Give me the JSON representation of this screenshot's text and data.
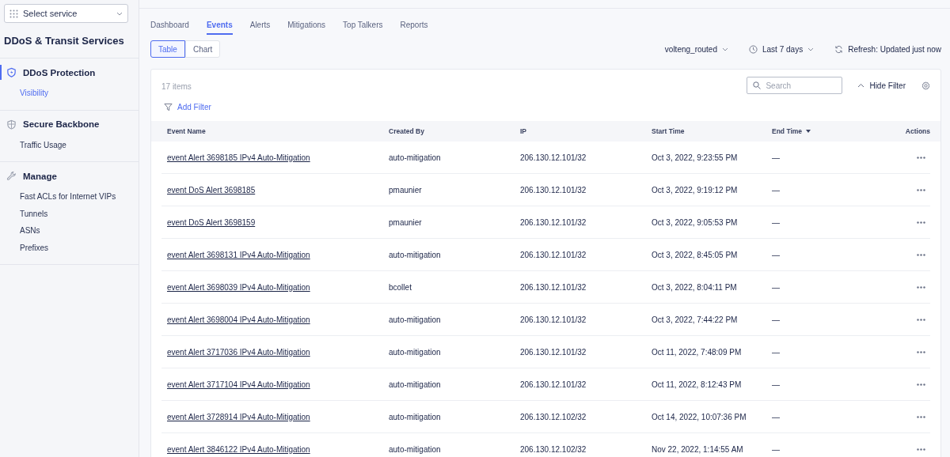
{
  "sidebar": {
    "service_select": {
      "placeholder": "Select service"
    },
    "title": "DDoS & Transit Services",
    "sections": [
      {
        "label": "DDoS Protection",
        "selected": true,
        "items": [
          {
            "label": "Visibility",
            "selected": true
          }
        ]
      },
      {
        "label": "Secure Backbone",
        "selected": false,
        "items": [
          {
            "label": "Traffic Usage",
            "selected": false
          }
        ]
      },
      {
        "label": "Manage",
        "selected": false,
        "items": [
          {
            "label": "Fast ACLs for Internet VIPs",
            "selected": false
          },
          {
            "label": "Tunnels",
            "selected": false
          },
          {
            "label": "ASNs",
            "selected": false
          },
          {
            "label": "Prefixes",
            "selected": false
          }
        ]
      }
    ]
  },
  "tabs": [
    {
      "label": "Dashboard",
      "selected": false
    },
    {
      "label": "Events",
      "selected": true
    },
    {
      "label": "Alerts",
      "selected": false
    },
    {
      "label": "Mitigations",
      "selected": false
    },
    {
      "label": "Top Talkers",
      "selected": false
    },
    {
      "label": "Reports",
      "selected": false
    }
  ],
  "views": [
    {
      "label": "Table",
      "selected": true
    },
    {
      "label": "Chart",
      "selected": false
    }
  ],
  "toolbar": {
    "account": "volteng_routed",
    "time_range": "Last 7 days",
    "refresh": "Refresh: Updated just now"
  },
  "table": {
    "count": "17 items",
    "search": {
      "placeholder": "Search"
    },
    "hide_filter": "Hide Filter",
    "add_filter": "Add Filter",
    "columns": [
      {
        "label": "Event Name",
        "sorted": false
      },
      {
        "label": "Created By",
        "sorted": false
      },
      {
        "label": "IP",
        "sorted": false
      },
      {
        "label": "Start Time",
        "sorted": false
      },
      {
        "label": "End Time",
        "sorted": true
      },
      {
        "label": "Actions",
        "sorted": false
      }
    ],
    "rows": [
      {
        "name": "event Alert 3698185 IPv4 Auto-Mitigation",
        "created_by": "auto-mitigation",
        "ip": "206.130.12.101/32",
        "start": "Oct 3, 2022, 9:23:55 PM",
        "end": "—"
      },
      {
        "name": "event DoS Alert 3698185",
        "created_by": "pmaunier",
        "ip": "206.130.12.101/32",
        "start": "Oct 3, 2022, 9:19:12 PM",
        "end": "—"
      },
      {
        "name": "event DoS Alert 3698159",
        "created_by": "pmaunier",
        "ip": "206.130.12.101/32",
        "start": "Oct 3, 2022, 9:05:53 PM",
        "end": "—"
      },
      {
        "name": "event Alert 3698131 IPv4 Auto-Mitigation",
        "created_by": "auto-mitigation",
        "ip": "206.130.12.101/32",
        "start": "Oct 3, 2022, 8:45:05 PM",
        "end": "—"
      },
      {
        "name": "event Alert 3698039 IPv4 Auto-Mitigation",
        "created_by": "bcollet",
        "ip": "206.130.12.101/32",
        "start": "Oct 3, 2022, 8:04:11 PM",
        "end": "—"
      },
      {
        "name": "event Alert 3698004 IPv4 Auto-Mitigation",
        "created_by": "auto-mitigation",
        "ip": "206.130.12.101/32",
        "start": "Oct 3, 2022, 7:44:22 PM",
        "end": "—"
      },
      {
        "name": "event Alert 3717036 IPv4 Auto-Mitigation",
        "created_by": "auto-mitigation",
        "ip": "206.130.12.101/32",
        "start": "Oct 11, 2022, 7:48:09 PM",
        "end": "—"
      },
      {
        "name": "event Alert 3717104 IPv4 Auto-Mitigation",
        "created_by": "auto-mitigation",
        "ip": "206.130.12.101/32",
        "start": "Oct 11, 2022, 8:12:43 PM",
        "end": "—"
      },
      {
        "name": "event Alert 3728914 IPv4 Auto-Mitigation",
        "created_by": "auto-mitigation",
        "ip": "206.130.12.102/32",
        "start": "Oct 14, 2022, 10:07:36 PM",
        "end": "—"
      },
      {
        "name": "event Alert 3846122 IPv4 Auto-Mitigation",
        "created_by": "auto-mitigation",
        "ip": "206.130.12.102/32",
        "start": "Nov 22, 2022, 1:14:55 AM",
        "end": "—"
      }
    ]
  }
}
